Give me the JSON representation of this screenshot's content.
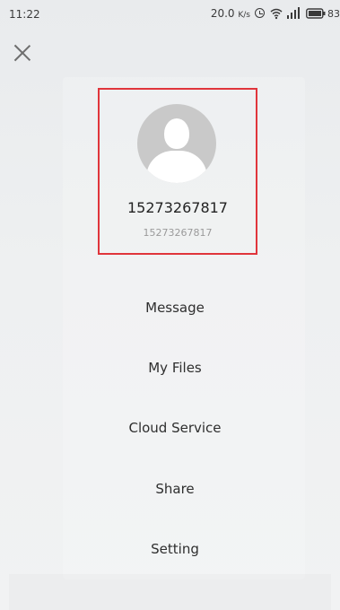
{
  "status_bar": {
    "time": "11:22",
    "network_speed": "20.0",
    "network_speed_unit": "K/s",
    "battery_level": "83"
  },
  "profile": {
    "name": "15273267817",
    "subtitle": "15273267817",
    "highlight_color": "#e0353b"
  },
  "menu": {
    "items": [
      {
        "label": "Message"
      },
      {
        "label": "My Files"
      },
      {
        "label": "Cloud Service"
      },
      {
        "label": "Share"
      },
      {
        "label": "Setting"
      }
    ]
  },
  "icons": {
    "close": "close-icon",
    "avatar": "avatar-placeholder-icon",
    "alarm": "alarm-icon",
    "wifi": "wifi-icon",
    "signal": "signal-icon",
    "battery": "battery-icon"
  }
}
